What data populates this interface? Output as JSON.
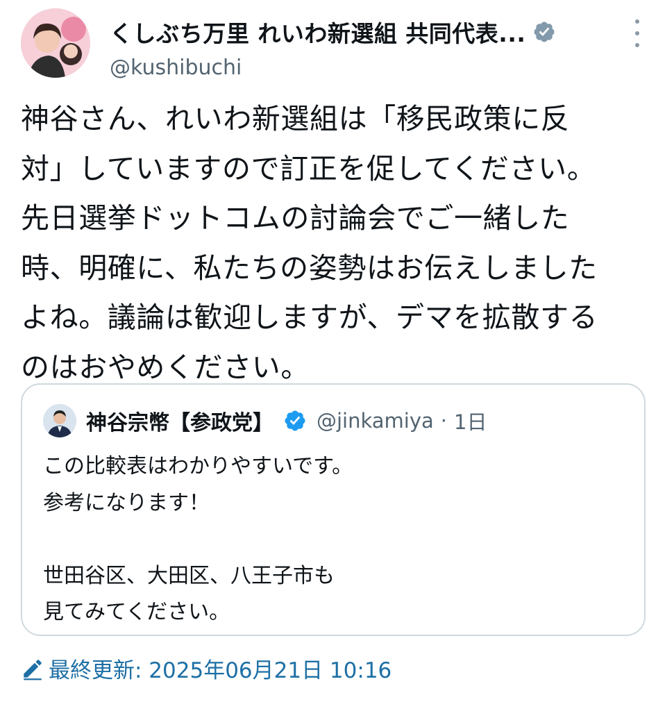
{
  "author": {
    "display_name": "くしぶち万里 れいわ新選組 共同代表...",
    "handle": "@kushibuchi",
    "avatar_icon": "profile-photo-avatar",
    "verified_icon": "verified-badge-gray-icon"
  },
  "more_icon": "more-options-icon",
  "tweet": {
    "lines": [
      "神谷さん、れいわ新選組は「移民政策に反",
      "対」していますので訂正を促してください。",
      "先日選挙ドットコムの討論会でご一緒した",
      "時、明確に、私たちの姿勢はお伝えしました",
      "よね。議論は歓迎しますが、デマを拡散する",
      "のはおやめください。"
    ]
  },
  "quoted": {
    "name": "神谷宗幣【参政党】",
    "handle": "@jinkamiya",
    "separator": "·",
    "time": "1日",
    "verified_icon": "verified-badge-blue-icon",
    "lines": [
      "この比較表はわかりやすいです。",
      "参考になります！",
      "",
      "世田谷区、大田区、八王子市も",
      "見てみてください。"
    ]
  },
  "footer": {
    "label": "最終更新: 2025年06月21日 10:16",
    "icon": "pencil-edit-icon"
  },
  "colors": {
    "text": "#0f1419",
    "secondary": "#536471",
    "link": "#1d6fa5",
    "verified_blue": "#1d9bf0",
    "verified_gray": "#829aab",
    "border": "#cfd9de"
  }
}
